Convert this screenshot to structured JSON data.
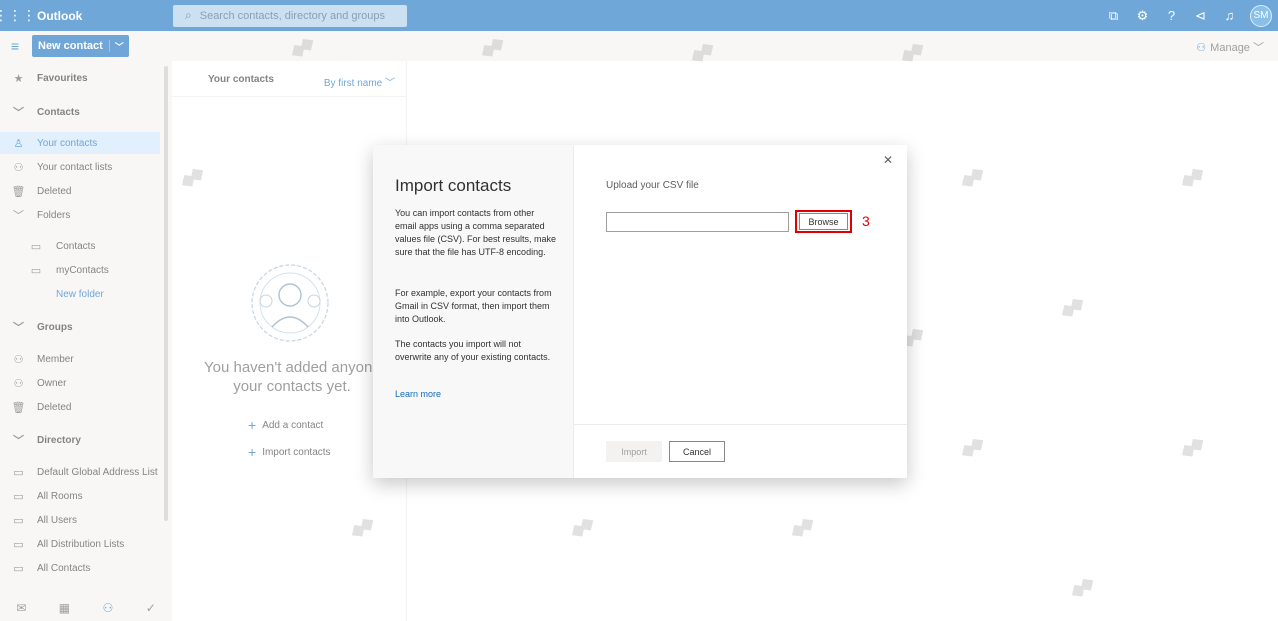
{
  "app": {
    "name": "Outlook",
    "search_placeholder": "Search contacts, directory and groups",
    "avatar_initials": "SM",
    "accent": "#0f6cbd"
  },
  "commandbar": {
    "new_contact": "New contact",
    "manage": "Manage"
  },
  "nav": {
    "favourites": "Favourites",
    "contacts_header": "Contacts",
    "your_contacts": "Your contacts",
    "your_contact_lists": "Your contact lists",
    "deleted": "Deleted",
    "folders": "Folders",
    "folder_contacts": "Contacts",
    "folder_mycontacts": "myContacts",
    "new_folder": "New folder",
    "groups": "Groups",
    "member": "Member",
    "owner": "Owner",
    "groups_deleted": "Deleted",
    "directory": "Directory",
    "default_global": "Default Global Address List",
    "all_rooms": "All Rooms",
    "all_users": "All Users",
    "all_distribution": "All Distribution Lists",
    "all_contacts": "All Contacts"
  },
  "list": {
    "header": "Your contacts",
    "sort": "By first name",
    "empty_line1": "You haven't added anyone to",
    "empty_line2": "your contacts yet.",
    "add_contact": "Add a contact",
    "import_contacts": "Import contacts"
  },
  "dialog": {
    "title": "Import contacts",
    "para1": "You can import contacts from other email apps using a comma separated values file (CSV). For best results, make sure that the file has UTF-8 encoding.",
    "para2": "For example, export your contacts from Gmail in CSV format, then import them into Outlook.",
    "para3": "The contacts you import will not overwrite any of your existing contacts.",
    "learn_more": "Learn more",
    "upload_label": "Upload your CSV file",
    "browse": "Browse",
    "step": "3",
    "import": "Import",
    "cancel": "Cancel"
  }
}
